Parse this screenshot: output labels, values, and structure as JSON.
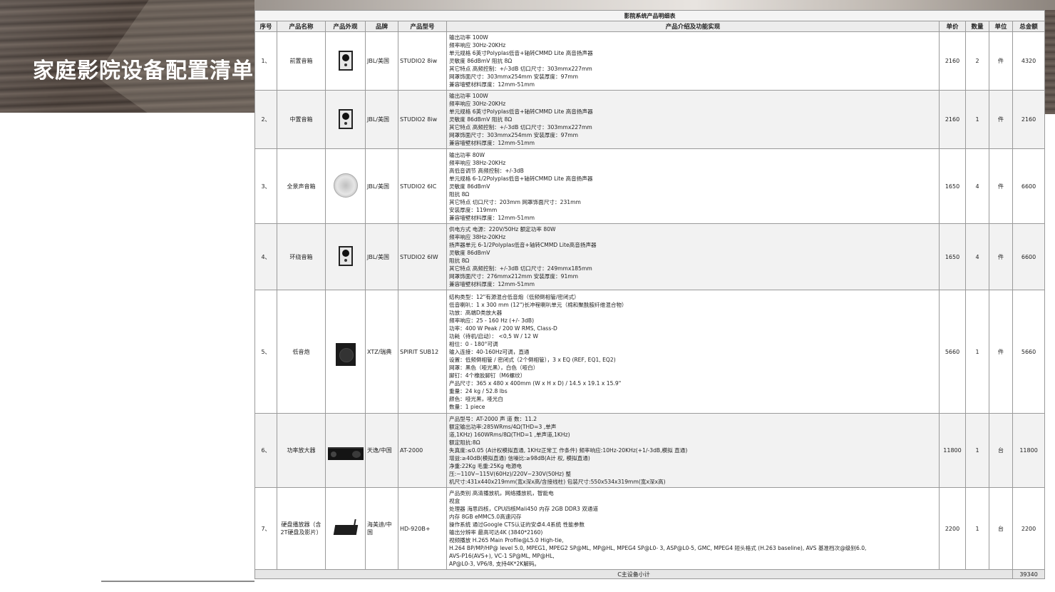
{
  "page": {
    "title": "家庭影院设备配置清单"
  },
  "table": {
    "title": "影院系统产品明细表",
    "headers": [
      "序号",
      "产品名称",
      "产品外观",
      "品牌",
      "产品型号",
      "产品介绍及功能实现",
      "单价",
      "数量",
      "单位",
      "总金额"
    ],
    "rows": [
      {
        "no": "1、",
        "name": "前置音箱",
        "image_icon": "wall-speaker-icon",
        "brand": "JBL/美国",
        "model": "STUDIO2 8iw",
        "desc": [
          "输出功率 100W",
          "频率响应 30Hz-20KHz",
          "单元规格 6英寸Polyplas低音+轴转CMMD Lite 高音扬声器",
          "灵敏度 86dBmV 阻抗 8Ω",
          "其它特点 高频控制：+/-3dB 切口尺寸：303mmx227mm",
          "网罩饰面尺寸：303mmx254mm 安装厚度：97mm",
          "兼容墙壁材料厚度：12mm-51mm"
        ],
        "price": "2160",
        "qty": "2",
        "unit": "件",
        "total": "4320"
      },
      {
        "no": "2、",
        "name": "中置音箱",
        "image_icon": "wall-speaker-icon",
        "brand": "JBL/美国",
        "model": "STUDIO2 8iw",
        "desc": [
          "输出功率 100W",
          "频率响应 30Hz-20KHz",
          "单元规格 6英寸Polyplas低音+轴转CMMD Lite 高音扬声器",
          "灵敏度 86dBmV 阻抗 8Ω",
          "其它特点 高频控制：+/-3dB 切口尺寸：303mmx227mm",
          "网罩饰面尺寸：303mmx254mm 安装厚度：97mm",
          "兼容墙壁材料厚度：12mm-51mm"
        ],
        "price": "2160",
        "qty": "1",
        "unit": "件",
        "total": "2160"
      },
      {
        "no": "3、",
        "name": "全景声音箱",
        "image_icon": "ceiling-speaker-icon",
        "brand": "JBL/美国",
        "model": "STUDIO2 6IC",
        "desc": [
          "输出功率 80W",
          "频率响应 38Hz-20KHz",
          "高低音调节 高频控制：+/-3dB",
          "单元规格 6-1/2Polyplas低音+轴转CMMD Lite 高音扬声器",
          "灵敏度 86dBmV",
          "阻抗 8Ω",
          "其它特点 切口尺寸：203mm 网罩饰面尺寸：231mm",
          "安装厚度：119mm",
          "兼容墙壁材料厚度：12mm-51mm"
        ],
        "price": "1650",
        "qty": "4",
        "unit": "件",
        "total": "6600"
      },
      {
        "no": "4、",
        "name": "环绕音箱",
        "image_icon": "wall-speaker-icon",
        "brand": "JBL/美国",
        "model": "STUDIO2 6IW",
        "desc": [
          "供电方式 电源：220V/50Hz 额定功率 80W",
          "频率响应 38Hz-20KHz",
          "扬声器单元 6-1/2Polyplas低音+轴转CMMD Lite高音扬声器",
          "灵敏度 86dBmV",
          "阻抗 8Ω",
          "其它特点 高频控制：+/-3dB 切口尺寸：249mmx185mm",
          "网罩饰面尺寸：276mmx212mm 安装厚度：91mm",
          "兼容墙壁材料厚度：12mm-51mm"
        ],
        "price": "1650",
        "qty": "4",
        "unit": "件",
        "total": "6600"
      },
      {
        "no": "5、",
        "name": "低音炮",
        "image_icon": "subwoofer-icon",
        "brand": "XTZ/瑞典",
        "model": "SPIRIT SUB12",
        "desc": [
          "结构类型：12\"有源混合低音炮（低频倒相管/密闭式）",
          "低音喇叭：1 x 300 mm (12\")长冲程喇叭单元（棉和聚酰胺纤维混合物）",
          "功放：高端D类放大器",
          "频率响应：25 - 160 Hz (+/- 3dB)",
          "功率：400 W Peak / 200 W RMS, Class-D",
          "功耗（待机/启动）： <0,5 W / 12 W",
          "相位：0 - 180°可调",
          "输入连接：40-160Hz可调，直通",
          "设置：低频倒相管 / 密闭式（2个倒相管），3 x EQ (REF, EQ1, EQ2)",
          "网罩：黑色（哑光黑），白色（哑白）",
          "脚钉：4个橡胶脚钉（M6螺纹）",
          "产品尺寸：365 x 480 x 400mm (W x H x D) / 14.5 x 19.1 x 15.9\"",
          "重量：24 kg / 52.8 lbs",
          "颜色：哑光黑，哑光白",
          "数量：1 piece"
        ],
        "price": "5660",
        "qty": "1",
        "unit": "件",
        "total": "5660"
      },
      {
        "no": "6、",
        "name": "功率放大器",
        "image_icon": "amplifier-icon",
        "brand": "天逸/中国",
        "model": "AT-2000",
        "desc": [
          "产品型号：AT-2000 声 道 数：11.2",
          "额定输出功率:285WRms/4Ω(THD=3 ,单声",
          "道,1KHz) 160WRms/8Ω(THD=1 ,单声道,1KHz)",
          "额定阻抗:8Ω",
          "失真度:≤0.05 (A计权模拟直通, 1KHz正常工 作条件) 频率响应:10Hz-20KHz(+1/-3dB,模拟 直通)",
          "增益:≥40dB(模拟直通) 信噪比:≥98dB(A计 权, 模拟直通)",
          "净重:22Kg 毛重:25Kg 电源电",
          "压:~110V~115V(60Hz)/220V~230V(50Hz) 整",
          "机尺寸:431x440x219mm(宽x深x高/含接线柱) 包装尺寸:550x534x319mm(宽x深x高)"
        ],
        "price": "11800",
        "qty": "1",
        "unit": "台",
        "total": "11800"
      },
      {
        "no": "7、",
        "name": "硬盘播放器（含2T硬盘及影片）",
        "image_icon": "media-player-icon",
        "brand": "海美迪/中国",
        "model": "HD-920B+",
        "desc": [
          "产品类别 高清播放机，网络播放机，智能电",
          "视盒",
          "处理器 海思四核，CPU四核Mali450 内存 2GB DDR3 双通道",
          "内存 8GB eMMC5.0高速闪存",
          "操作系统 通过Google CTS认证的安卓4.4系统 性能参数",
          "输出分辨率 最高可达4K (3840*2160)",
          "视频播放 H.265 Main Profile@L5.0 High-tie,",
          "H.264 BP/MP/HP@ level 5.0, MPEG1, MPEG2 SP@ML, MP@HL, MPEG4 SP@L0- 3, ASP@L0-5, GMC, MPEG4 短头格式 (H.263 baseline), AVS 基准档次@级别6.0,",
          "AVS-P16(AVS+), VC-1 SP@ML, MP@HL,",
          "AP@L0-3, VP6/8, 支持4K*2K解码。"
        ],
        "price": "2200",
        "qty": "1",
        "unit": "台",
        "total": "2200"
      }
    ],
    "footer": {
      "label": "C主设备小计",
      "total": "39340"
    }
  }
}
